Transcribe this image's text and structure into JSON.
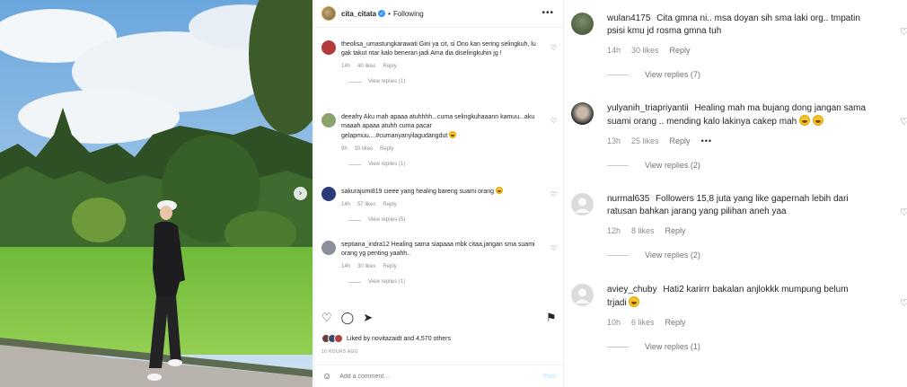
{
  "post": {
    "author": "cita_citata",
    "follow_status": "Following",
    "separator": "•",
    "more_icon": "more-horizontal-icon",
    "comments": [
      {
        "user": "theolisa_umastungkarawati",
        "text": "Gini ya cit, si Ono kan sering selingkuh, lu gak takut ntar kalo beneran jadi Ama dia diselingkuhin jg !",
        "time": "14h",
        "likes": "40 likes",
        "reply": "Reply",
        "replies": "View replies (1)"
      },
      {
        "user": "deeafry",
        "text": "Aku mah apaaa atuhhhh...cuma selingkuhaaann kamuu...aku maaah apaaa atuhh cuma pacar gelapmuu....#cumanyanyilagudangdut",
        "time": "9h",
        "likes": "10 likes",
        "reply": "Reply",
        "replies": "View replies (1)"
      },
      {
        "user": "sakurajumi819",
        "text": "cieee yang healing bareng suami orang",
        "time": "14h",
        "likes": "57 likes",
        "reply": "Reply",
        "replies": "View replies (5)"
      },
      {
        "user": "septiana_indra12",
        "text": "Healing sama siapaaa mbk citaa,jangan sma suami orang yg penting yaahh..",
        "time": "14h",
        "likes": "30 likes",
        "reply": "Reply",
        "replies": "View replies (1)"
      }
    ],
    "liked_by_prefix": "Liked by",
    "liked_by_user": "novitazaidt",
    "liked_by_suffix": "and 4,570 others",
    "date": "16 HOURS AGO",
    "add_comment_placeholder": "Add a comment...",
    "post_button": "Post"
  },
  "comments_panel": [
    {
      "user": "wulan4175",
      "text": "Cita gmna ni.. msa doyan sih sma laki org.. tmpatin psisi kmu jd rosma gmna tuh",
      "time": "14h",
      "likes": "30 likes",
      "reply": "Reply",
      "replies": "View replies (7)"
    },
    {
      "user": "yulyanih_triapriyantii",
      "text": "Healing mah ma bujang dong jangan sama suami orang .. mending kalo lakinya cakep mah",
      "time": "13h",
      "likes": "25 likes",
      "reply": "Reply",
      "more": "•••",
      "replies": "View replies (2)"
    },
    {
      "user": "nurmal635",
      "text": "Followers 15,8 juta yang like gapernah lebih dari ratusan bahkan jarang yang pilihan aneh yaa",
      "time": "12h",
      "likes": "8 likes",
      "reply": "Reply",
      "replies": "View replies (2)"
    },
    {
      "user": "aviey_chuby",
      "text": "Hati2 karirrr bakalan anjlokkk mumpung belum trjadi",
      "time": "10h",
      "likes": "6 likes",
      "reply": "Reply",
      "replies": "View replies (1)"
    }
  ],
  "colors": {
    "sky": "#7fb2e0",
    "grass": "#7bc043",
    "link_blue": "#3897f0",
    "muted": "#8e8e8e"
  }
}
